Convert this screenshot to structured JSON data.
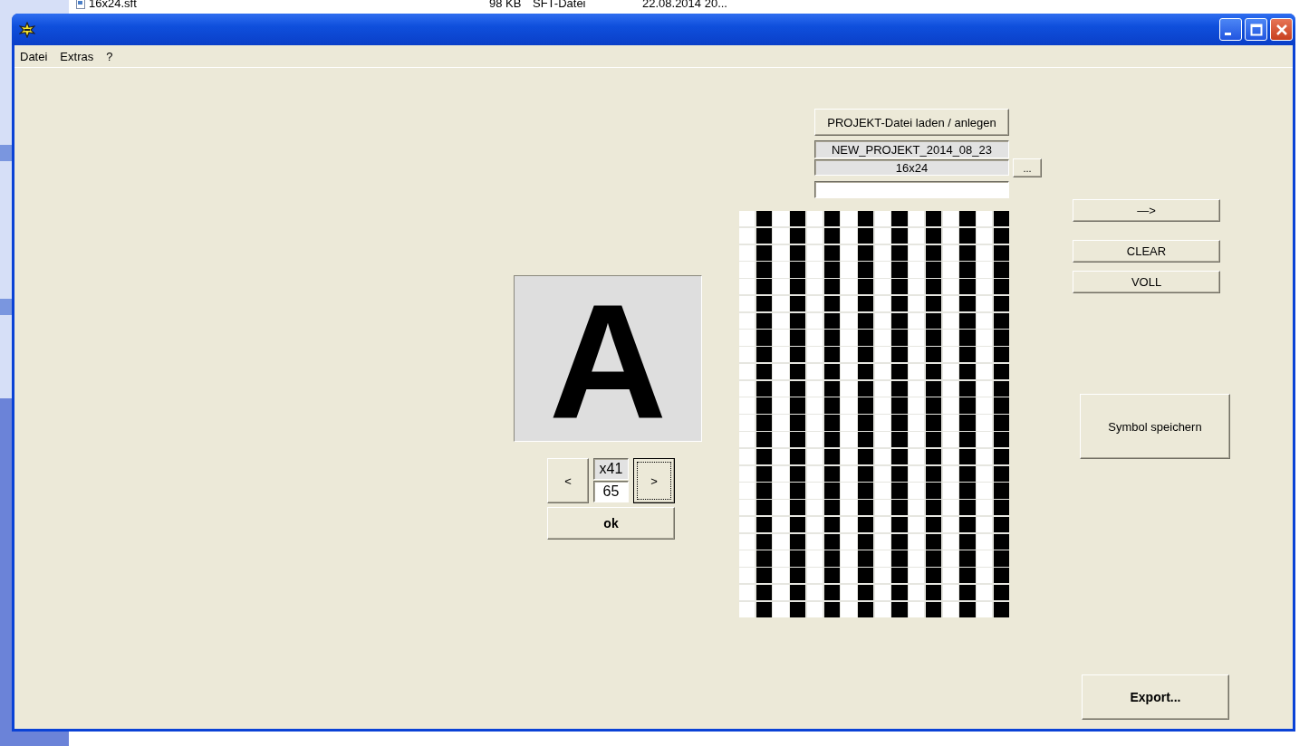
{
  "background_file_row": {
    "name": "16x24.sft",
    "size": "98 KB",
    "type": "SFT-Datei",
    "date": "22.08.2014 20..."
  },
  "menu": [
    "Datei",
    "Extras",
    "?"
  ],
  "project": {
    "load_button": "PROJEKT-Datei laden / anlegen",
    "project_name": "NEW_PROJEKT_2014_08_23",
    "format": "16x24",
    "browse_button": "..."
  },
  "preview": {
    "glyph": "A"
  },
  "navigation": {
    "prev_button": "<",
    "hex_code": "x41",
    "code_value": "65",
    "next_button": ">",
    "next_focused": true,
    "ok_button": "ok"
  },
  "grid": [
    [
      false,
      true,
      false,
      true,
      false,
      true,
      false,
      true,
      false,
      true,
      false,
      true,
      false,
      true,
      false,
      true
    ],
    [
      false,
      true,
      false,
      true,
      false,
      true,
      false,
      true,
      false,
      true,
      false,
      true,
      false,
      true,
      false,
      true
    ],
    [
      false,
      true,
      false,
      true,
      false,
      true,
      false,
      true,
      false,
      true,
      false,
      true,
      false,
      true,
      false,
      true
    ],
    [
      false,
      true,
      false,
      true,
      false,
      true,
      false,
      true,
      false,
      true,
      false,
      true,
      false,
      true,
      false,
      true
    ],
    [
      false,
      true,
      false,
      true,
      false,
      true,
      false,
      true,
      false,
      true,
      false,
      true,
      false,
      true,
      false,
      true
    ],
    [
      false,
      true,
      false,
      true,
      false,
      true,
      false,
      true,
      false,
      true,
      false,
      true,
      false,
      true,
      false,
      true
    ],
    [
      false,
      true,
      false,
      true,
      false,
      true,
      false,
      true,
      false,
      true,
      false,
      true,
      false,
      true,
      false,
      true
    ],
    [
      false,
      true,
      false,
      true,
      false,
      true,
      false,
      true,
      false,
      true,
      false,
      true,
      false,
      true,
      false,
      true
    ],
    [
      false,
      true,
      false,
      true,
      false,
      true,
      false,
      true,
      false,
      true,
      false,
      true,
      false,
      true,
      false,
      true
    ],
    [
      false,
      true,
      false,
      true,
      false,
      true,
      false,
      true,
      false,
      true,
      false,
      true,
      false,
      true,
      false,
      true
    ],
    [
      false,
      true,
      false,
      true,
      false,
      true,
      false,
      true,
      false,
      true,
      false,
      true,
      false,
      true,
      false,
      true
    ],
    [
      false,
      true,
      false,
      true,
      false,
      true,
      false,
      true,
      false,
      true,
      false,
      true,
      false,
      true,
      false,
      true
    ],
    [
      false,
      true,
      false,
      true,
      false,
      true,
      false,
      true,
      false,
      true,
      false,
      true,
      false,
      true,
      false,
      true
    ],
    [
      false,
      true,
      false,
      true,
      false,
      true,
      false,
      true,
      false,
      true,
      false,
      true,
      false,
      true,
      false,
      true
    ],
    [
      false,
      true,
      false,
      true,
      false,
      true,
      false,
      true,
      false,
      true,
      false,
      true,
      false,
      true,
      false,
      true
    ],
    [
      false,
      true,
      false,
      true,
      false,
      true,
      false,
      true,
      false,
      true,
      false,
      true,
      false,
      true,
      false,
      true
    ],
    [
      false,
      true,
      false,
      true,
      false,
      true,
      false,
      true,
      false,
      true,
      false,
      true,
      false,
      true,
      false,
      true
    ],
    [
      false,
      true,
      false,
      true,
      false,
      true,
      false,
      true,
      false,
      true,
      false,
      true,
      false,
      true,
      false,
      true
    ],
    [
      false,
      true,
      false,
      true,
      false,
      true,
      false,
      true,
      false,
      true,
      false,
      true,
      false,
      true,
      false,
      true
    ],
    [
      false,
      true,
      false,
      true,
      false,
      true,
      false,
      true,
      false,
      true,
      false,
      true,
      false,
      true,
      false,
      true
    ],
    [
      false,
      true,
      false,
      true,
      false,
      true,
      false,
      true,
      false,
      true,
      false,
      true,
      false,
      true,
      false,
      true
    ],
    [
      false,
      true,
      false,
      true,
      false,
      true,
      false,
      true,
      false,
      true,
      false,
      true,
      false,
      true,
      false,
      true
    ],
    [
      false,
      true,
      false,
      true,
      false,
      true,
      false,
      true,
      false,
      true,
      false,
      true,
      false,
      true,
      false,
      true
    ],
    [
      false,
      true,
      false,
      true,
      false,
      true,
      false,
      true,
      false,
      true,
      false,
      true,
      false,
      true,
      false,
      true
    ]
  ],
  "actions": {
    "arrow_button": "—>",
    "clear_button": "CLEAR",
    "fill_button": "VOLL",
    "save_button": "Symbol speichern",
    "export_button": "Export..."
  }
}
